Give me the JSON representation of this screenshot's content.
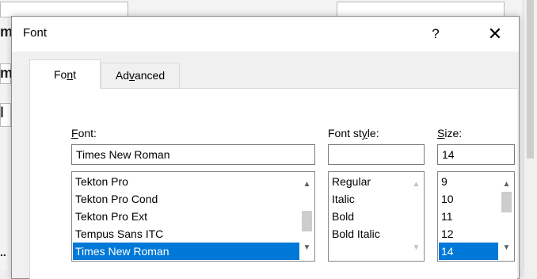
{
  "dialog": {
    "title": "Font",
    "help_label": "?",
    "close_label": "✕"
  },
  "tabs": {
    "font_label_parts": [
      "Fo",
      "n",
      "t"
    ],
    "advanced_label_parts": [
      "Ad",
      "v",
      "anced"
    ]
  },
  "font": {
    "label_parts": [
      "",
      "F",
      "ont:"
    ],
    "value": "Times New Roman",
    "items": [
      {
        "label": "Tekton Pro",
        "selected": false
      },
      {
        "label": "Tekton Pro Cond",
        "selected": false
      },
      {
        "label": "Tekton Pro Ext",
        "selected": false
      },
      {
        "label": "Tempus Sans ITC",
        "selected": false
      },
      {
        "label": "Times New Roman",
        "selected": true
      }
    ]
  },
  "font_style": {
    "label_parts": [
      "Font st",
      "y",
      "le:"
    ],
    "value": "",
    "items": [
      {
        "label": "Regular",
        "selected": false
      },
      {
        "label": "Italic",
        "selected": false
      },
      {
        "label": "Bold",
        "selected": false
      },
      {
        "label": "Bold Italic",
        "selected": false
      }
    ]
  },
  "size": {
    "label_parts": [
      "",
      "S",
      "ize:"
    ],
    "value": "14",
    "items": [
      {
        "label": "9",
        "selected": false
      },
      {
        "label": "10",
        "selected": false
      },
      {
        "label": "11",
        "selected": false
      },
      {
        "label": "12",
        "selected": false
      },
      {
        "label": "14",
        "selected": true
      }
    ]
  },
  "icons": {
    "scroll_up": "▲",
    "scroll_down": "▼"
  },
  "colors": {
    "selection": "#0078d7",
    "selection_text": "#ffffff"
  }
}
